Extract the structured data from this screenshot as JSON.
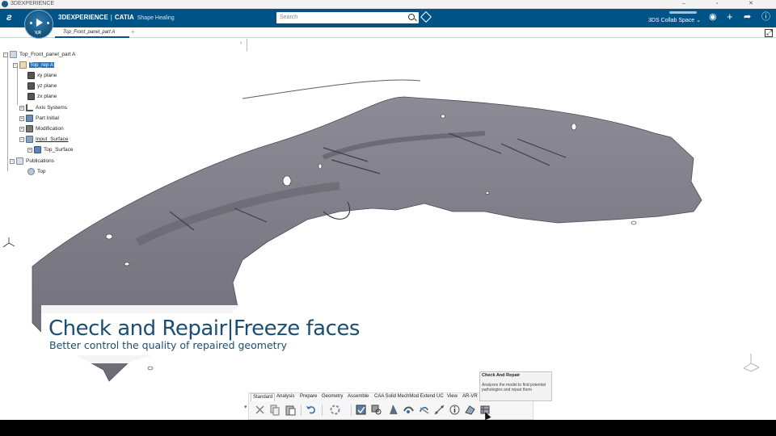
{
  "os": {
    "title": "3DEXPERIENCE",
    "controls": [
      "–",
      "▫",
      "✕"
    ]
  },
  "app": {
    "brand": "3DEXPERIENCE",
    "product": "CATIA",
    "module": "Shape Healing",
    "compass_label": "V,R",
    "search_placeholder": "Search",
    "collab_space": "3DS Collab Space",
    "accent": "#005386"
  },
  "tabs": [
    {
      "label": "Top_Front_panel_part A",
      "active": true
    }
  ],
  "tree": {
    "root": "Top_Front_panel_part A",
    "rep": "Top_rep A",
    "planes": [
      "xy plane",
      "yz plane",
      "zx plane"
    ],
    "items": [
      "Axis Systems",
      "Part Initial",
      "Modification",
      "Input_Surface"
    ],
    "input_child": "Top_Surface",
    "publications": "Publications",
    "pub_child": "Top"
  },
  "overlay": {
    "title": "Check and Repair|Freeze faces",
    "subtitle": "Better control the quality of repaired geometry"
  },
  "actionbar": {
    "tabs": [
      "Standard",
      "Analysis",
      "Prepare",
      "Geometry",
      "Assemble",
      "CAA Solid MechMod Extend UC",
      "View",
      "AR-VR"
    ],
    "active_tab": "Standard",
    "tools": [
      "cut-icon",
      "copy-icon",
      "paste-icon",
      "undo-icon",
      "update-icon",
      "check-icon",
      "inspect-icon",
      "analysis-icon",
      "heal-icon",
      "refresh-icon",
      "curve-icon",
      "info-icon",
      "surface-icon",
      "check-and-repair-icon"
    ]
  },
  "tooltip": {
    "title": "Check And Repair",
    "body": "Analyzes the model to find potential pathologies and repair them"
  }
}
